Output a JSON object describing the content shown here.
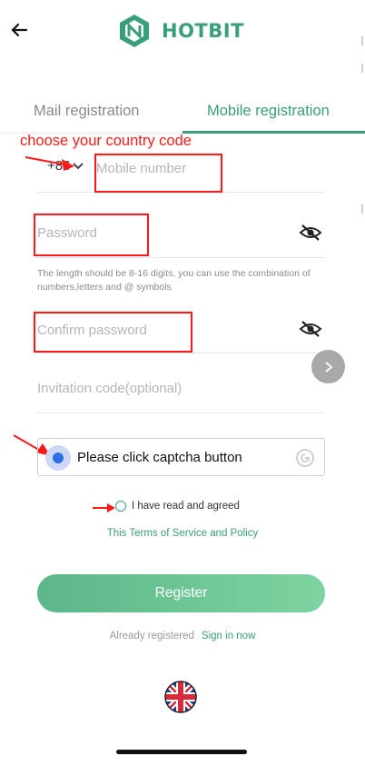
{
  "header": {
    "logo_text": "HOTBIT"
  },
  "tabs": [
    {
      "label": "Mail registration",
      "active": false
    },
    {
      "label": "Mobile registration",
      "active": true
    }
  ],
  "annotation": {
    "text": "choose your country code",
    "color": "#ff1a1a"
  },
  "form": {
    "country_code": "+86",
    "mobile_placeholder": "Mobile number",
    "password_placeholder": "Password",
    "password_hint": "The length should be 8-16 digits, you can use the combination of numbers,letters and @ symbols",
    "confirm_placeholder": "Confirm password",
    "invitation_placeholder": "Invitation code(optional)",
    "captcha_label": "Please click captcha button",
    "agree_label": "I have read and agreed",
    "terms_label": "This Terms of Service and Policy",
    "register_label": "Register",
    "already_label": "Already registered",
    "signin_label": "Sign in now"
  },
  "colors": {
    "brand": "#3a9e7a",
    "button_gradient_start": "#5cb689",
    "button_gradient_end": "#7dd4a0"
  },
  "icons": {
    "back": "back-arrow-icon",
    "eye": "eye-hidden-icon",
    "next": "chevron-right-icon",
    "captcha": "captcha-logo-icon",
    "flag": "uk-flag-icon"
  }
}
